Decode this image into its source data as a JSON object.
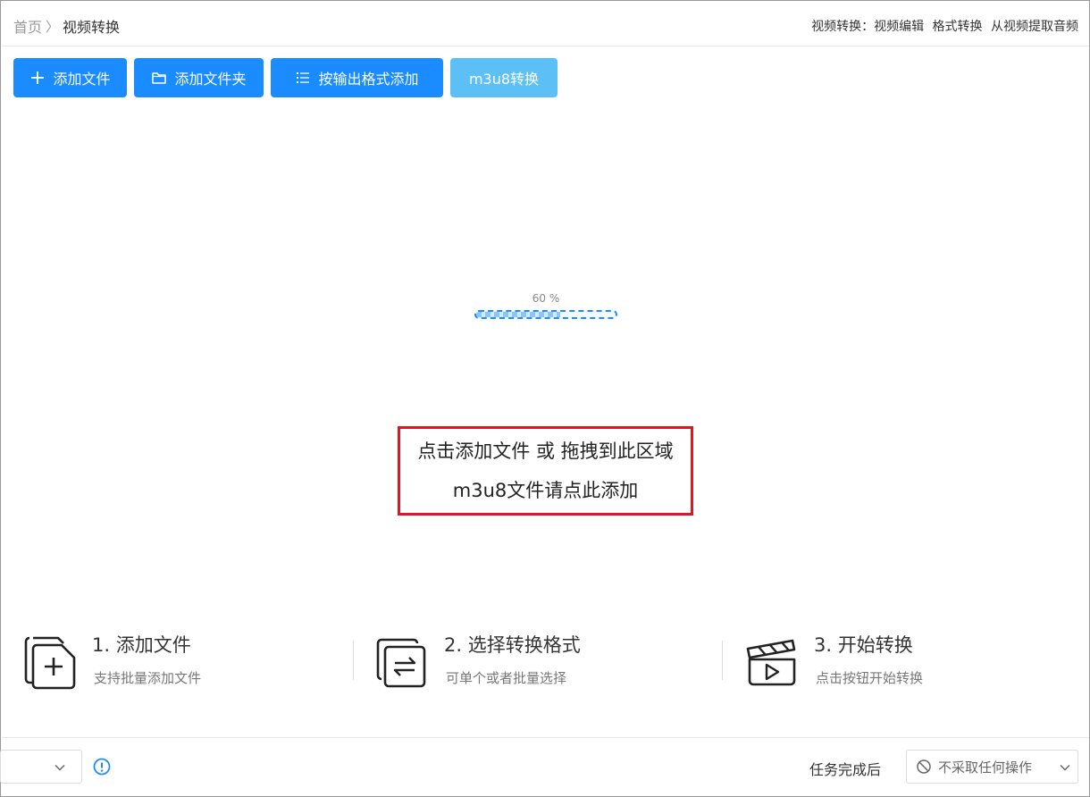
{
  "header": {
    "breadcrumb": {
      "home": "首页",
      "separator": "〉",
      "current": "视频转换"
    },
    "right": {
      "prefix": "视频转换：",
      "links": [
        "视频编辑",
        "格式转换",
        "从视频提取音频"
      ]
    }
  },
  "toolbar": {
    "buttons": [
      {
        "label": "添加文件",
        "icon": "plus-icon"
      },
      {
        "label": "添加文件夹",
        "icon": "folder-icon"
      },
      {
        "label": "按输出格式添加",
        "icon": "list-icon"
      },
      {
        "label": "m3u8转换",
        "icon": ""
      }
    ]
  },
  "progress": {
    "label": "60 %",
    "value": 0.6
  },
  "dropzone": {
    "line1": "点击添加文件 或 拖拽到此区域",
    "line2": "m3u8文件请点此添加"
  },
  "steps": [
    {
      "title": "1. 添加文件",
      "desc": "支持批量添加文件",
      "icon": "add-file-icon"
    },
    {
      "title": "2. 选择转换格式",
      "desc": "可单个或者批量选择",
      "icon": "convert-format-icon"
    },
    {
      "title": "3. 开始转换",
      "desc": "点击按钮开始转换",
      "icon": "clapperboard-icon"
    }
  ],
  "bottom": {
    "after_label": "任务完成后",
    "after_select_value": "不采取任何操作"
  },
  "colors": {
    "primary": "#1a8cff",
    "light_button": "#5cc0f7",
    "dropzone_border": "#e0161f"
  }
}
